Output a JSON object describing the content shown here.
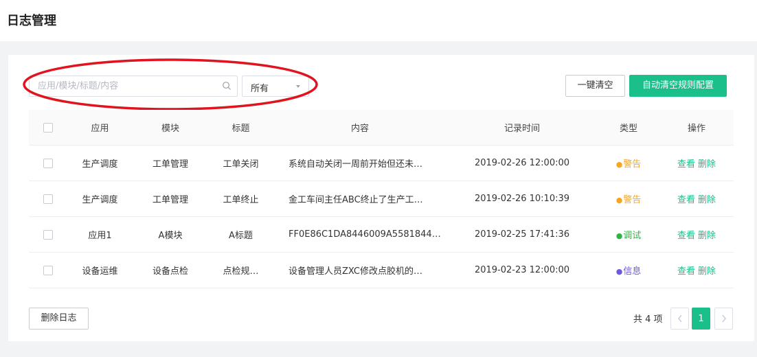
{
  "page": {
    "title": "日志管理"
  },
  "toolbar": {
    "search_placeholder": "应用/模块/标题/内容",
    "search_value": "",
    "filter_selected": "所有",
    "clear_all_label": "一键清空",
    "auto_clear_label": "自动清空规则配置"
  },
  "table": {
    "headers": [
      "应用",
      "模块",
      "标题",
      "内容",
      "记录时间",
      "类型",
      "操作"
    ],
    "rows": [
      {
        "app": "生产调度",
        "module": "工单管理",
        "title": "工单关闭",
        "content": "系统自动关闭一周前开始但还未…",
        "time": "2019-02-26 12:00:00",
        "type": "警告",
        "type_color": "#f5a623"
      },
      {
        "app": "生产调度",
        "module": "工单管理",
        "title": "工单终止",
        "content": "金工车间主任ABC终止了生产工…",
        "time": "2019-02-26 10:10:39",
        "type": "警告",
        "type_color": "#f5a623"
      },
      {
        "app": "应用1",
        "module": "A模块",
        "title": "A标题",
        "content": "FF0E86C1DA8446009A5581844…",
        "time": "2019-02-25 17:41:36",
        "type": "调试",
        "type_color": "#2fb344"
      },
      {
        "app": "设备运维",
        "module": "设备点检",
        "title": "点检规…",
        "content": "设备管理人员ZXC修改点胶机的…",
        "time": "2019-02-23 12:00:00",
        "type": "信息",
        "type_color": "#6b5bd6"
      }
    ],
    "actions": {
      "view": "查看",
      "delete": "删除"
    }
  },
  "footer": {
    "delete_log_label": "删除日志",
    "total_text": "共 4 项",
    "current_page": "1"
  },
  "colors": {
    "accent": "#1bbf8a",
    "annotation": "#e0141e"
  }
}
